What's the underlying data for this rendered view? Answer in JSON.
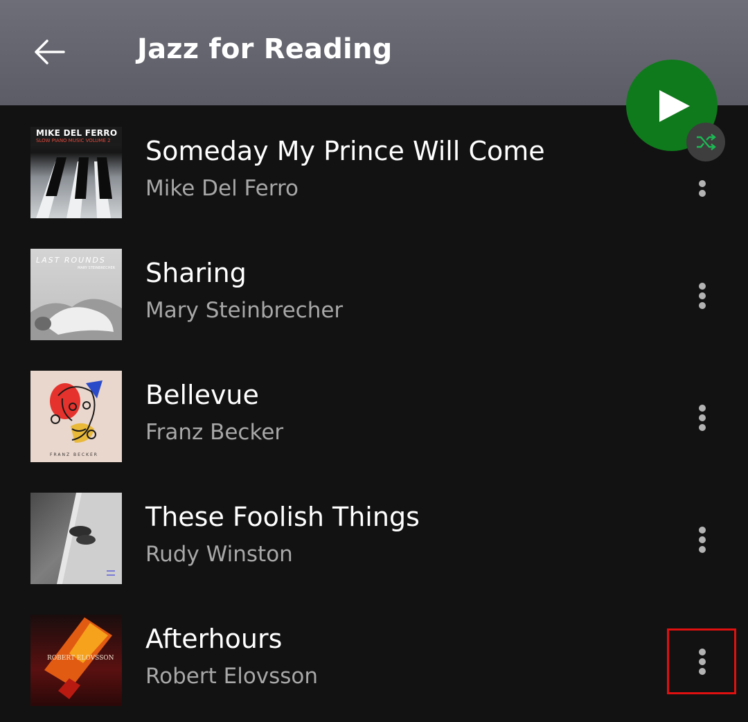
{
  "header": {
    "title": "Jazz for Reading"
  },
  "colors": {
    "accent": "#1db954",
    "play_button": "#0f7a1c",
    "background": "#121212",
    "header": "#66666f",
    "subtext": "#a8a8a8",
    "highlight_box": "#e01010"
  },
  "tracks": [
    {
      "title": "Someday My Prince Will Come",
      "artist": "Mike Del Ferro",
      "cover_line1": "MIKE DEL FERRO",
      "cover_line2": "SLOW PIANO MUSIC VOLUME 2"
    },
    {
      "title": "Sharing",
      "artist": "Mary Steinbrecher",
      "cover_line1": "LAST ROUNDS",
      "cover_line2": "MARY STEINBRECHER"
    },
    {
      "title": "Bellevue",
      "artist": "Franz Becker",
      "cover_line1": "FRANZ BECKER"
    },
    {
      "title": "These Foolish Things",
      "artist": "Rudy Winston"
    },
    {
      "title": "Afterhours",
      "artist": "Robert Elovsson",
      "cover_line1": "ROBERT ELOVSSON"
    }
  ]
}
